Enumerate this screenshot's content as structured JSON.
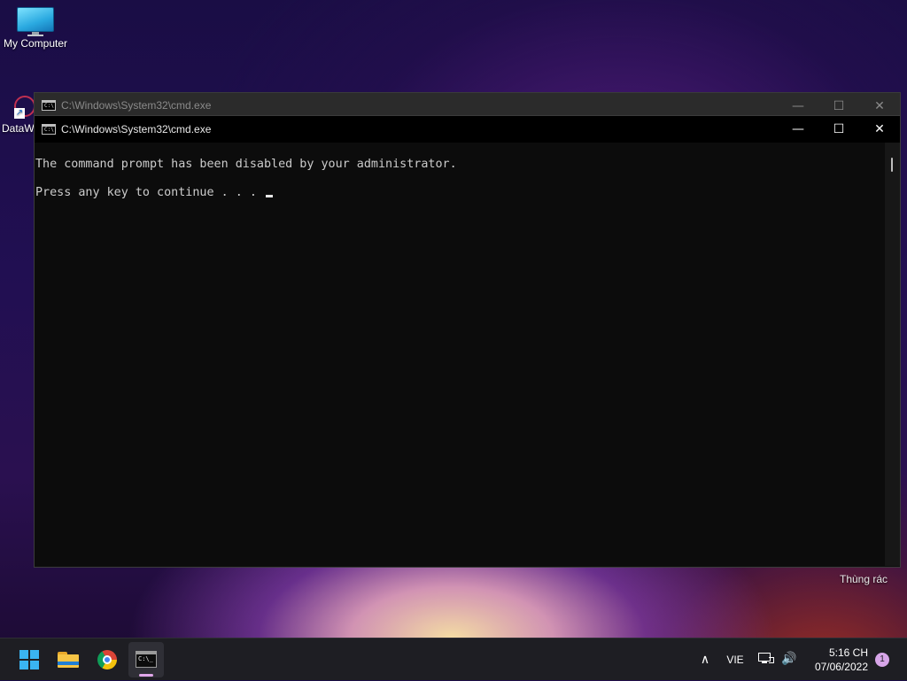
{
  "desktop": {
    "icons": [
      {
        "label": "My Computer"
      },
      {
        "label": "DataW"
      }
    ],
    "recycle_bin_label": "Thùng rác"
  },
  "background_window": {
    "title": "C:\\Windows\\System32\\cmd.exe"
  },
  "window": {
    "title": "C:\\Windows\\System32\\cmd.exe",
    "minimize_glyph": "—",
    "maximize_glyph": "☐",
    "close_glyph": "✕",
    "console_lines": [
      "The command prompt has been disabled by your administrator.",
      "Press any key to continue . . . "
    ]
  },
  "taskbar": {
    "apps": [
      {
        "name": "start",
        "icon": "windows-logo-icon"
      },
      {
        "name": "file-explorer",
        "icon": "folder-icon"
      },
      {
        "name": "chrome",
        "icon": "chrome-icon"
      },
      {
        "name": "command-prompt",
        "icon": "cmd-icon",
        "active": true
      }
    ],
    "tray": {
      "chevron": "∧",
      "language": "VIE",
      "volume_glyph": "🔊",
      "time": "5:16 CH",
      "date": "07/06/2022",
      "notification_count": "1"
    }
  },
  "colors": {
    "accent_windows": "#3ab4f2",
    "console_bg": "#0c0c0c",
    "console_text": "#cccccc",
    "taskbar_bg": "#1e1e23"
  }
}
